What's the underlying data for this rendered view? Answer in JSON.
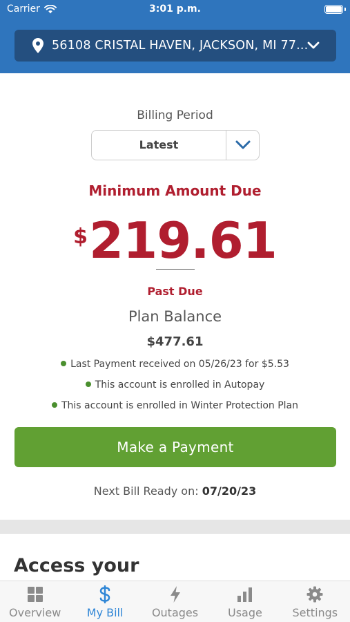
{
  "status_bar": {
    "carrier": "Carrier",
    "time": "3:01 p.m."
  },
  "header": {
    "address": "56108 CRISTAL HAVEN, JACKSON, MI 77..."
  },
  "billing": {
    "period_label": "Billing Period",
    "period_value": "Latest",
    "min_due_label": "Minimum Amount Due",
    "currency_symbol": "$",
    "amount": "219.61",
    "past_due": "Past Due",
    "plan_balance_label": "Plan Balance",
    "plan_balance_value": "$477.61",
    "notices": [
      "Last Payment received on 05/26/23 for $5.53",
      "This account is enrolled in Autopay",
      "This account is enrolled in Winter Protection Plan"
    ],
    "pay_button": "Make a Payment",
    "next_bill_label": "Next Bill Ready on:",
    "next_bill_date": "07/20/23"
  },
  "access_title": "Access your",
  "tabs": [
    {
      "label": "Overview",
      "icon": "grid-icon"
    },
    {
      "label": "My Bill",
      "icon": "dollar-icon",
      "active": true
    },
    {
      "label": "Outages",
      "icon": "lightning-icon"
    },
    {
      "label": "Usage",
      "icon": "bar-chart-icon"
    },
    {
      "label": "Settings",
      "icon": "gear-icon"
    }
  ],
  "colors": {
    "header": "#2f75bd",
    "address_bar": "#244f7f",
    "accent_red": "#b01e2f",
    "pay_green": "#61a033",
    "active_tab": "#2f86d6"
  }
}
